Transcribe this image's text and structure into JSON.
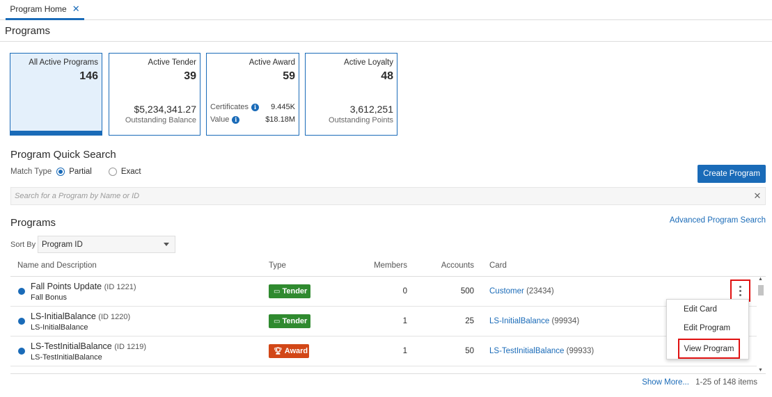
{
  "tabs": [
    {
      "label": "Program Home",
      "close": "✕"
    }
  ],
  "page_title": "Programs",
  "summary_cards": [
    {
      "title": "All Active Programs",
      "count": "146"
    },
    {
      "title": "Active Tender",
      "count": "39",
      "amount": "$5,234,341.27",
      "sub": "Outstanding Balance"
    },
    {
      "title": "Active Award",
      "count": "59",
      "certificates_label": "Certificates",
      "certificates_value": "9.445K",
      "value_label": "Value",
      "value_value": "$18.18M"
    },
    {
      "title": "Active Loyalty",
      "count": "48",
      "amount": "3,612,251",
      "sub": "Outstanding Points"
    }
  ],
  "quick_search": {
    "title": "Program Quick Search",
    "match_type_label": "Match Type",
    "options": [
      "Partial",
      "Exact"
    ],
    "selected": "Partial",
    "placeholder": "Search for a Program by Name or ID",
    "create_button": "Create Program"
  },
  "programs": {
    "title": "Programs",
    "advanced_search": "Advanced Program Search",
    "sort_by_label": "Sort By",
    "sort_by_value": "Program ID",
    "columns": [
      "Name and Description",
      "Type",
      "Members",
      "Accounts",
      "Card"
    ],
    "rows": [
      {
        "name": "Fall Points Update",
        "id": "(ID 1221)",
        "desc": "Fall Bonus",
        "type": "Tender",
        "members": "0",
        "accounts": "500",
        "card": "Customer",
        "card_num": "(23434)"
      },
      {
        "name": "LS-InitialBalance",
        "id": "(ID 1220)",
        "desc": "LS-InitialBalance",
        "type": "Tender",
        "members": "1",
        "accounts": "25",
        "card": "LS-InitialBalance",
        "card_num": "(99934)"
      },
      {
        "name": "LS-TestInitialBalance",
        "id": "(ID 1219)",
        "desc": "LS-TestInitialBalance",
        "type": "Award",
        "members": "1",
        "accounts": "50",
        "card": "LS-TestInitialBalance",
        "card_num": "(99933)"
      }
    ],
    "show_more": "Show More...",
    "range": "1-25 of 148 items"
  },
  "row_menu": {
    "items": [
      "Edit Card",
      "Edit Program",
      "View Program"
    ]
  },
  "colors": {
    "accent": "#1a6bb8",
    "tender": "#2f8a2f",
    "award": "#d24717",
    "highlight": "#e01010"
  },
  "icons": {
    "tender_badge": "card-icon",
    "award_badge": "trophy-icon",
    "info": "info-icon",
    "row_actions": "kebab-icon"
  }
}
